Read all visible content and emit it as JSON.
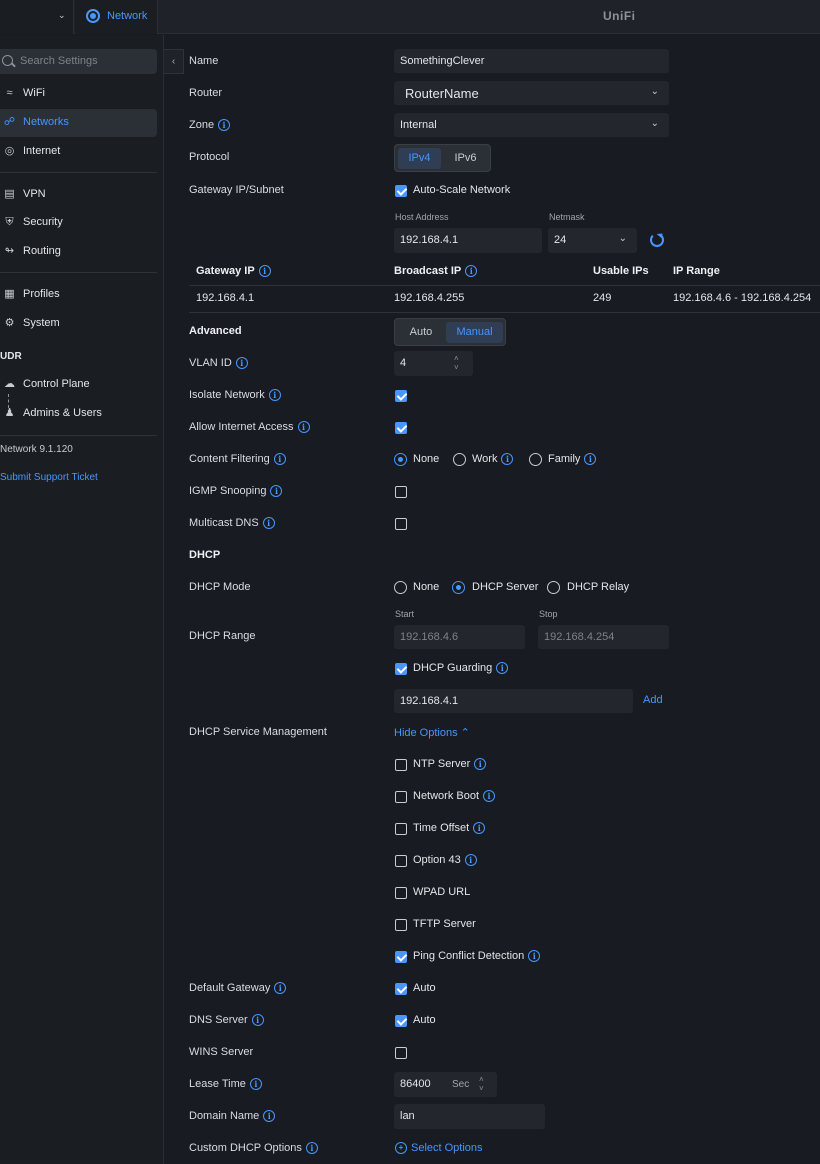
{
  "topbar": {
    "app_tab": "Network",
    "brand": "UniFi"
  },
  "sidebar": {
    "search_placeholder": "Search Settings",
    "items": [
      {
        "label": "WiFi",
        "icon": "wifi-icon"
      },
      {
        "label": "Networks",
        "icon": "networks-icon",
        "active": true
      },
      {
        "label": "Internet",
        "icon": "globe-icon"
      },
      {
        "label": "VPN",
        "icon": "vpn-icon"
      },
      {
        "label": "Security",
        "icon": "shield-icon"
      },
      {
        "label": "Routing",
        "icon": "routing-icon"
      },
      {
        "label": "Profiles",
        "icon": "profiles-icon"
      },
      {
        "label": "System",
        "icon": "system-icon"
      }
    ],
    "section": "UDR",
    "udr_items": [
      {
        "label": "Control Plane",
        "icon": "control-plane-icon"
      },
      {
        "label": "Admins & Users",
        "icon": "users-icon"
      }
    ],
    "version": "Network 9.1.120",
    "support": "Submit Support Ticket"
  },
  "form": {
    "name": {
      "label": "Name",
      "value": "SomethingClever"
    },
    "router": {
      "label": "Router",
      "value": "RouterName"
    },
    "zone": {
      "label": "Zone",
      "value": "Internal"
    },
    "protocol": {
      "label": "Protocol",
      "options": [
        "IPv4",
        "IPv6"
      ],
      "selected": "IPv4"
    },
    "gateway": {
      "label": "Gateway IP/Subnet",
      "auto_scale": "Auto-Scale Network",
      "host_label": "Host Address",
      "host_value": "192.168.4.1",
      "netmask_label": "Netmask",
      "netmask_value": "24"
    },
    "table": {
      "headers": [
        "Gateway IP",
        "Broadcast IP",
        "Usable IPs",
        "IP Range"
      ],
      "row": [
        "192.168.4.1",
        "192.168.4.255",
        "249",
        "192.168.4.6 - 192.168.4.254"
      ]
    },
    "advanced": {
      "label": "Advanced",
      "options": [
        "Auto",
        "Manual"
      ],
      "selected": "Manual"
    },
    "vlan": {
      "label": "VLAN ID",
      "value": "4"
    },
    "isolate": {
      "label": "Isolate Network",
      "checked": true
    },
    "internet": {
      "label": "Allow Internet Access",
      "checked": true
    },
    "content_filtering": {
      "label": "Content Filtering",
      "options": [
        "None",
        "Work",
        "Family"
      ],
      "selected": "None"
    },
    "igmp": {
      "label": "IGMP Snooping",
      "checked": false
    },
    "mdns": {
      "label": "Multicast DNS",
      "checked": false
    },
    "dhcp_heading": "DHCP",
    "dhcp_mode": {
      "label": "DHCP Mode",
      "options": [
        "None",
        "DHCP Server",
        "DHCP Relay"
      ],
      "selected": "DHCP Server"
    },
    "dhcp_range": {
      "label": "DHCP Range",
      "start_label": "Start",
      "start": "192.168.4.6",
      "stop_label": "Stop",
      "stop": "192.168.4.254"
    },
    "dhcp_guarding": {
      "label": "DHCP Guarding",
      "checked": true,
      "value": "192.168.4.1",
      "add": "Add"
    },
    "service_mgmt": {
      "label": "DHCP Service Management",
      "toggle": "Hide Options",
      "options": [
        {
          "label": "NTP Server",
          "checked": false,
          "info": true
        },
        {
          "label": "Network Boot",
          "checked": false,
          "info": true
        },
        {
          "label": "Time Offset",
          "checked": false,
          "info": true
        },
        {
          "label": "Option 43",
          "checked": false,
          "info": true
        },
        {
          "label": "WPAD URL",
          "checked": false,
          "info": false
        },
        {
          "label": "TFTP Server",
          "checked": false,
          "info": false
        },
        {
          "label": "Ping Conflict Detection",
          "checked": true,
          "info": true
        }
      ]
    },
    "default_gateway": {
      "label": "Default Gateway",
      "value": "Auto",
      "checked": true
    },
    "dns_server": {
      "label": "DNS Server",
      "value": "Auto",
      "checked": true
    },
    "wins": {
      "label": "WINS Server",
      "checked": false
    },
    "lease": {
      "label": "Lease Time",
      "value": "86400",
      "unit": "Sec"
    },
    "domain": {
      "label": "Domain Name",
      "value": "lan"
    },
    "custom": {
      "label": "Custom DHCP Options",
      "action": "Select Options"
    }
  },
  "colors": {
    "accent": "#4797ff",
    "background": "#181b21",
    "sidebar": "#1a1d22"
  }
}
